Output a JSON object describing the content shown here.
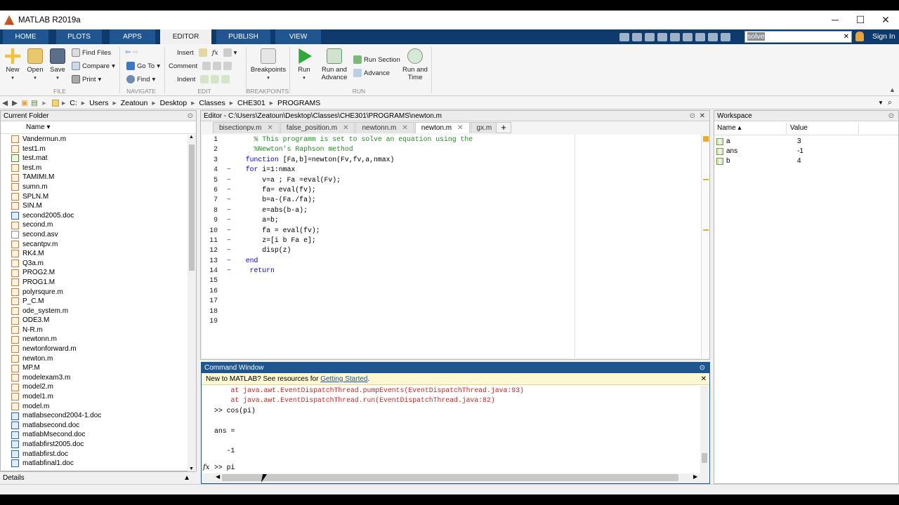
{
  "window": {
    "title": "MATLAB R2019a",
    "minimize": "─",
    "maximize": "☐",
    "close": "✕"
  },
  "tabs": [
    {
      "label": "HOME"
    },
    {
      "label": "PLOTS"
    },
    {
      "label": "APPS"
    },
    {
      "label": "EDITOR"
    },
    {
      "label": "PUBLISH"
    },
    {
      "label": "VIEW"
    }
  ],
  "search": {
    "value": "solve"
  },
  "sign_in": "Sign In",
  "ribbon": {
    "file": {
      "new": "New",
      "open": "Open",
      "save": "Save",
      "find_files": "Find Files",
      "compare": "Compare",
      "print": "Print",
      "group": "FILE"
    },
    "navigate": {
      "go_to": "Go To",
      "find": "Find",
      "group": "NAVIGATE"
    },
    "edit": {
      "insert": "Insert",
      "comment": "Comment",
      "indent": "Indent",
      "fx": "fx",
      "group": "EDIT"
    },
    "breakpoints": {
      "label": "Breakpoints",
      "group": "BREAKPOINTS"
    },
    "run": {
      "run": "Run",
      "run_and_advance": "Run and Advance",
      "run_section": "Run Section",
      "advance": "Advance",
      "run_and_time": "Run and Time",
      "group": "RUN"
    }
  },
  "address": {
    "crumbs": [
      "C:",
      "Users",
      "Zeatoun",
      "Desktop",
      "Classes",
      "CHE301",
      "PROGRAMS"
    ]
  },
  "current_folder": {
    "title": "Current Folder",
    "column": "Name ▾",
    "files": [
      {
        "name": "Vandermun.m",
        "type": "m"
      },
      {
        "name": "test1.m",
        "type": "m"
      },
      {
        "name": "test.mat",
        "type": "mat"
      },
      {
        "name": "test.m",
        "type": "m"
      },
      {
        "name": "TAMIMI.M",
        "type": "m"
      },
      {
        "name": "sumn.m",
        "type": "m"
      },
      {
        "name": "SPLN.M",
        "type": "m"
      },
      {
        "name": "SIN.M",
        "type": "m"
      },
      {
        "name": "second2005.doc",
        "type": "doc"
      },
      {
        "name": "second.m",
        "type": "m"
      },
      {
        "name": "second.asv",
        "type": "other"
      },
      {
        "name": "secantpv.m",
        "type": "m"
      },
      {
        "name": "RK4.M",
        "type": "m"
      },
      {
        "name": "Q3a.m",
        "type": "m"
      },
      {
        "name": "PROG2.M",
        "type": "m"
      },
      {
        "name": "PROG1.M",
        "type": "m"
      },
      {
        "name": "polyrsqure.m",
        "type": "m"
      },
      {
        "name": "P_C.M",
        "type": "m"
      },
      {
        "name": "ode_system.m",
        "type": "m"
      },
      {
        "name": "ODE3.M",
        "type": "m"
      },
      {
        "name": "N-R.m",
        "type": "m"
      },
      {
        "name": "newtonn.m",
        "type": "m"
      },
      {
        "name": "newtonforward.m",
        "type": "m"
      },
      {
        "name": "newton.m",
        "type": "m"
      },
      {
        "name": "MP.M",
        "type": "m"
      },
      {
        "name": "modelexam3.m",
        "type": "m"
      },
      {
        "name": "model2.m",
        "type": "m"
      },
      {
        "name": "model1.m",
        "type": "m"
      },
      {
        "name": "model.m",
        "type": "m"
      },
      {
        "name": "matlabsecond2004-1.doc",
        "type": "doc"
      },
      {
        "name": "matlabsecond.doc",
        "type": "doc"
      },
      {
        "name": "matlabMsecond.doc",
        "type": "doc"
      },
      {
        "name": "matlabfirst2005.doc",
        "type": "doc"
      },
      {
        "name": "matlabfirst.doc",
        "type": "doc"
      },
      {
        "name": "matlabfinal1.doc",
        "type": "doc"
      }
    ]
  },
  "details": "Details",
  "editor": {
    "title": "Editor - C:\\Users\\Zeatoun\\Desktop\\Classes\\CHE301\\PROGRAMS\\newton.m",
    "tabs": [
      "bisectionpv.m",
      "false_position.m",
      "newtonn.m",
      "newton.m",
      "gx.m"
    ],
    "active_tab": 3,
    "line_numbers": [
      "1",
      "2",
      "3",
      "4",
      "5",
      "6",
      "7",
      "8",
      "9",
      "10",
      "11",
      "12",
      "13",
      "14",
      "15",
      "16",
      "17",
      "18",
      "19"
    ],
    "markers": [
      "",
      "",
      "",
      "−",
      "−",
      "−",
      "−",
      "−",
      "−",
      "−",
      "−",
      "−",
      "−",
      "−",
      "",
      "",
      "",
      "",
      ""
    ],
    "lines": [
      [
        {
          "t": "    ",
          "c": ""
        },
        {
          "t": "% This programm is set to solve an equation using the",
          "c": "cmt"
        }
      ],
      [
        {
          "t": "    ",
          "c": ""
        },
        {
          "t": "%Newton's Raphson method",
          "c": "cmt"
        }
      ],
      [
        {
          "t": "  ",
          "c": ""
        },
        {
          "t": "function",
          "c": "kw"
        },
        {
          "t": " [Fa,b]=newton(Fv,fv,a,nmax)",
          "c": ""
        }
      ],
      [
        {
          "t": "  ",
          "c": ""
        },
        {
          "t": "for",
          "c": "kw"
        },
        {
          "t": " i=1:nmax",
          "c": ""
        }
      ],
      [
        {
          "t": "      v=a ; Fa =eval(Fv);",
          "c": ""
        }
      ],
      [
        {
          "t": "      fa= eval(fv);",
          "c": ""
        }
      ],
      [
        {
          "t": "      b=a-(Fa./fa);",
          "c": ""
        }
      ],
      [
        {
          "t": "      e=abs(b-a);",
          "c": ""
        }
      ],
      [
        {
          "t": "      a=b;",
          "c": ""
        }
      ],
      [
        {
          "t": "      fa = eval(fv);",
          "c": ""
        }
      ],
      [
        {
          "t": "      z=[i b Fa e];",
          "c": ""
        }
      ],
      [
        {
          "t": "      disp(z)",
          "c": ""
        }
      ],
      [
        {
          "t": "  ",
          "c": ""
        },
        {
          "t": "end",
          "c": "kw"
        }
      ],
      [
        {
          "t": "   ",
          "c": ""
        },
        {
          "t": "return",
          "c": "kw"
        }
      ],
      [],
      [],
      [],
      [],
      []
    ]
  },
  "command_window": {
    "title": "Command Window",
    "notice_prefix": "New to MATLAB? See resources for ",
    "notice_link": "Getting Started",
    "notice_suffix": ".",
    "lines": [
      {
        "t": "    at java.awt.EventDispatchThread.pumpEvents(EventDispatchThread.java:93)",
        "c": "err"
      },
      {
        "t": "    at java.awt.EventDispatchThread.run(EventDispatchThread.java:82)",
        "c": "err"
      },
      {
        "t": ">> cos(pi)",
        "c": ""
      },
      {
        "t": "",
        "c": ""
      },
      {
        "t": "ans =",
        "c": ""
      },
      {
        "t": "",
        "c": ""
      },
      {
        "t": "   -1",
        "c": ""
      }
    ],
    "prompt_line": ">> pi",
    "fx": "fx"
  },
  "workspace": {
    "title": "Workspace",
    "col_name": "Name ▴",
    "col_value": "Value",
    "vars": [
      {
        "name": "a",
        "value": "3"
      },
      {
        "name": "ans",
        "value": "-1"
      },
      {
        "name": "b",
        "value": "4"
      }
    ]
  }
}
